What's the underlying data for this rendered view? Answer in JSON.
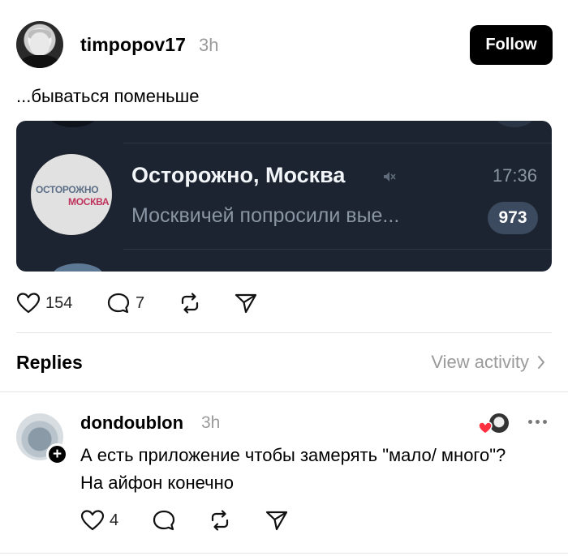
{
  "post": {
    "username": "timpopov17",
    "time": "3h",
    "follow_label": "Follow",
    "text": "...бываться поменьше",
    "image": {
      "channel_name": "Осторожно, Москва",
      "channel_time": "17:36",
      "channel_message": "Москвичей попросили вые...",
      "unread_count": "973",
      "logo_line1": "ОСТОРОЖНО",
      "logo_line2": "МОСКВА"
    },
    "actions": {
      "likes": "154",
      "comments": "7"
    }
  },
  "replies_section": {
    "title": "Replies",
    "view_activity_label": "View activity"
  },
  "reply": {
    "username": "dondoublon",
    "time": "3h",
    "text": "А есть приложение чтобы замерять \"мало/ много\"? На айфон конечно",
    "likes": "4"
  },
  "colors": {
    "follow_bg": "#000000",
    "image_bg": "#1c2431",
    "badge_bg": "#3b4a5e",
    "heart_red": "#ff3040"
  },
  "icons": [
    "heart-icon",
    "comment-icon",
    "repost-icon",
    "share-icon",
    "mute-icon",
    "chevron-right-icon",
    "more-icon",
    "plus-icon"
  ]
}
